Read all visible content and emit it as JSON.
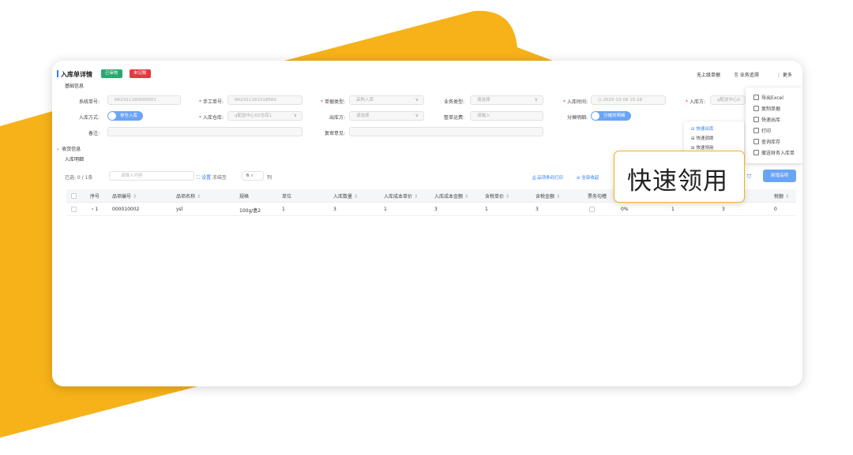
{
  "colors": {
    "accent_yellow": "#f7b21a",
    "primary_blue": "#2f7cf6",
    "success_green": "#29a96e",
    "danger_red": "#e5393f"
  },
  "header": {
    "title": "入库单详情",
    "status_badge": "已审核",
    "remark_badge": "未记账",
    "prev_label": "无上级单据",
    "business_trace": "业务追溯",
    "more": "更多"
  },
  "section_basic": "基础信息",
  "form": {
    "system_no_label": "系统单号:",
    "system_no_value": "RK2311180000001",
    "manual_no_label": "手工单号:",
    "manual_no_value": "RK2311181518560",
    "doc_type_label": "单据类型:",
    "doc_type_value": "采购入库",
    "biz_type_label": "业务类型:",
    "biz_type_value": "请选择",
    "in_time_label": "入库时间:",
    "in_time_value": "2025-10-08 15:18",
    "in_party_label": "入库方:",
    "in_party_value": "q配送中心0",
    "in_method_label": "入库方式:",
    "in_method_value": "单仓入库",
    "warehouse_label": "入库仓库:",
    "warehouse_value": "q配送中心02仓库1",
    "out_party_label": "出库方:",
    "out_party_value": "请选择",
    "freight_label": "整单运费:",
    "freight_value": "请输入",
    "split_label": "分摊明细:",
    "split_value": "分摊到明细",
    "remark_label": "备注:",
    "review_label": "复审意见:"
  },
  "section_receipt": "收货信息",
  "section_detail": "入库明细",
  "toolbar": {
    "selected": "已选: 0 / 1条",
    "search_placeholder": "请输入内容",
    "setting_label": "设置",
    "freeze_label": "冻结至",
    "freeze_value": "6",
    "col_label": "列",
    "print_barcode": "品项条码打印",
    "collapse_all": "全部收起",
    "add_item": "新增品项"
  },
  "table": {
    "headers": [
      "序号",
      "品项编号",
      "品项名称",
      "规格",
      "单位",
      "入库数量",
      "入库成本单价",
      "入库成本金额",
      "含税单价",
      "含税金额",
      "票务勾稽",
      "税额"
    ],
    "rows": [
      {
        "index": "1",
        "code": "000010002",
        "name": "ysl",
        "spec": "100g/盒2",
        "unit": "1",
        "qty": "3",
        "unit_cost": "1",
        "cost_amount": "3",
        "tax_price": "1",
        "tax_amount": "3",
        "tax_rate": "0%",
        "col13": "1",
        "col14": "3",
        "tax": "0"
      }
    ]
  },
  "menu": {
    "items": [
      "导出Excel",
      "复制单据",
      "快速出库",
      "打印",
      "查询库存",
      "撤送财务入库单"
    ]
  },
  "submenu": {
    "items": [
      "快速出库",
      "快速调拨",
      "快速领用"
    ]
  },
  "callout": "快速领用"
}
